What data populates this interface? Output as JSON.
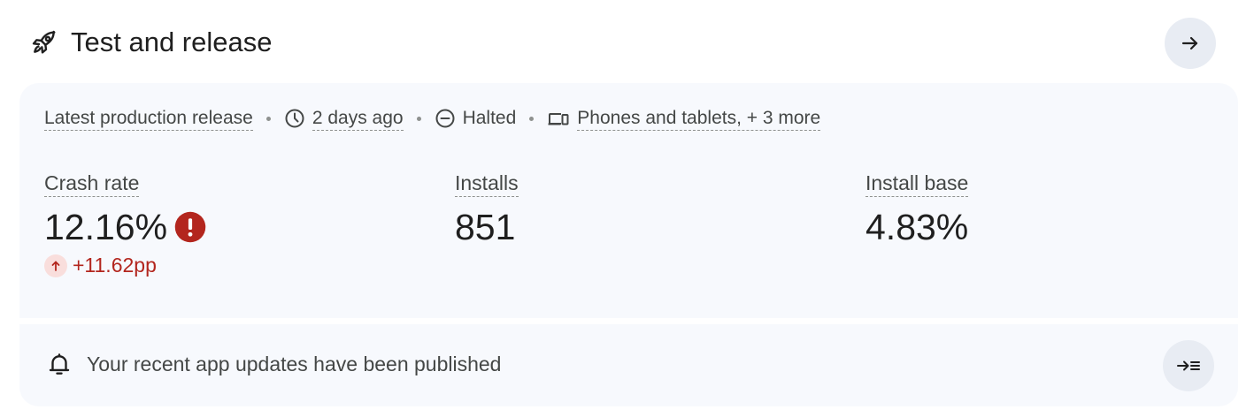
{
  "header": {
    "title": "Test and release",
    "icon": "rocket-icon"
  },
  "release": {
    "label": "Latest production release",
    "time": "2 days ago",
    "status": "Halted",
    "devices": "Phones and tablets, + 3 more"
  },
  "metrics": {
    "crash_rate": {
      "label": "Crash rate",
      "value": "12.16%",
      "delta": "+11.62pp"
    },
    "installs": {
      "label": "Installs",
      "value": "851"
    },
    "install_base": {
      "label": "Install base",
      "value": "4.83%"
    }
  },
  "notification": {
    "text": "Your recent app updates have been published"
  },
  "colors": {
    "error": "#b3261e",
    "error_bg": "#f9dedc",
    "card_bg": "#f7f9fd",
    "button_bg": "#e8ecf3"
  }
}
